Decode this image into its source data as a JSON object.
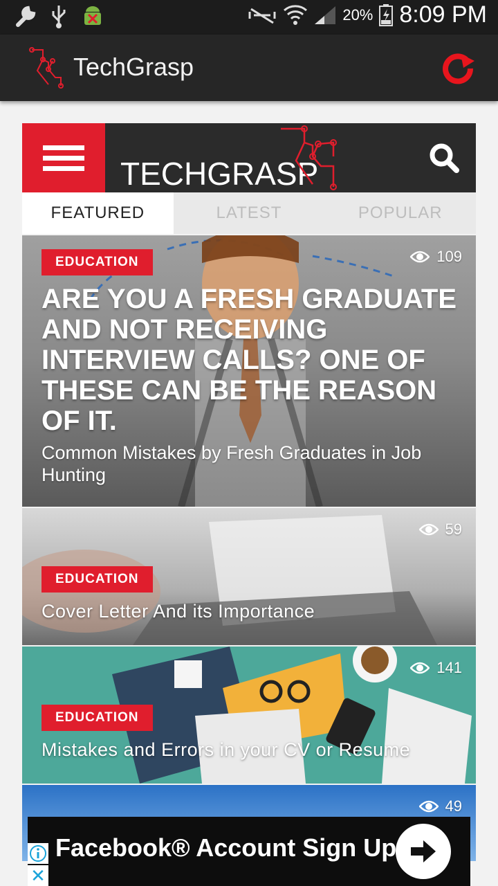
{
  "status_bar": {
    "battery": "20%",
    "time": "8:09 PM"
  },
  "app_bar": {
    "title": "TechGrasp"
  },
  "brand": {
    "wordmark": "TECHGRASP"
  },
  "tabs": [
    {
      "label": "FEATURED",
      "active": true
    },
    {
      "label": "LATEST",
      "active": false
    },
    {
      "label": "POPULAR",
      "active": false
    }
  ],
  "featured": {
    "category": "EDUCATION",
    "views": "109",
    "headline": "ARE YOU A FRESH GRADUATE AND NOT RECEIVING INTERVIEW CALLS? ONE OF THESE CAN BE THE REASON OF IT.",
    "subtitle": "Common Mistakes by Fresh Graduates in Job Hunting"
  },
  "articles": [
    {
      "category": "EDUCATION",
      "views": "59",
      "title": "Cover Letter And its Importance"
    },
    {
      "category": "EDUCATION",
      "views": "141",
      "title": "Mistakes and Errors in your CV or Resume"
    },
    {
      "views": "49"
    }
  ],
  "ad": {
    "text": "Facebook® Account Sign Up",
    "close": "✕"
  },
  "colors": {
    "accent": "#e01e2d",
    "appbar": "#262626",
    "statusbar": "#1c1c1c"
  },
  "icons": [
    "wrench-icon",
    "usb-icon",
    "android-icon",
    "mute-icon",
    "wifi-icon",
    "signal-icon",
    "battery-icon",
    "refresh-icon",
    "menu-icon",
    "search-icon",
    "eye-icon",
    "arrow-icon",
    "info-icon",
    "close-icon"
  ]
}
